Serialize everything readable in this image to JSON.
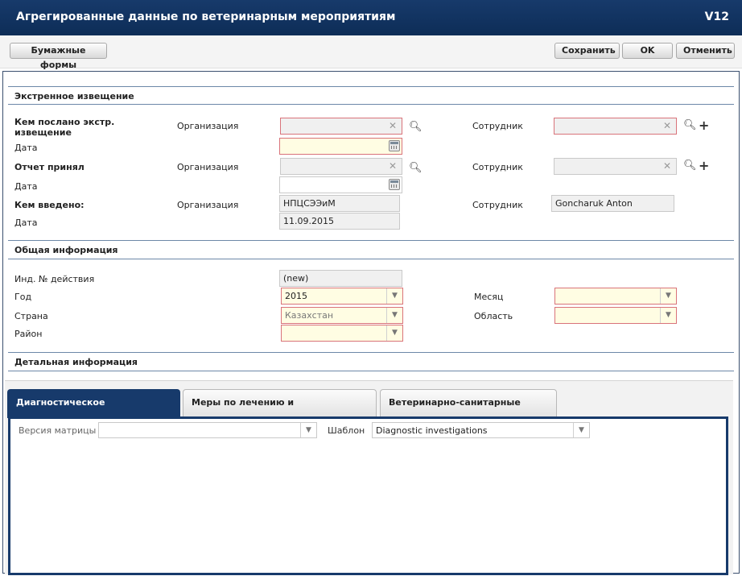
{
  "window": {
    "title": "Агрегированные данные по ветеринарным мероприятиям",
    "version": "V12"
  },
  "toolbar": {
    "paper_forms": "Бумажные формы",
    "save": "Сохранить",
    "ok": "OK",
    "cancel": "Отменить"
  },
  "emergency": {
    "title": "Экстренное извещение",
    "sent_by": "Кем послано экстр. извещение",
    "report_received": "Отчет принял",
    "entered_by": "Кем введено:",
    "org_label": "Организация",
    "employee_label": "Сотрудник",
    "date_label": "Дата",
    "entered_org": "НПЦСЭЭиМ",
    "entered_employee": "Goncharuk Anton",
    "entered_date": "11.09.2015"
  },
  "general": {
    "title": "Общая информация",
    "action_id_label": "Инд. № действия",
    "action_id_value": "(new)",
    "year_label": "Год",
    "year_value": "2015",
    "country_label": "Страна",
    "country_value": "Казахстан",
    "district_label": "Район",
    "month_label": "Месяц",
    "region_label": "Область"
  },
  "detail": {
    "title": "Детальная информация",
    "tabs": [
      {
        "label": "Диагностическое исследование",
        "active": true
      },
      {
        "label": "Меры по лечению и профилактике",
        "active": false
      },
      {
        "label": "Ветеринарно-санитарные меры",
        "active": false
      }
    ],
    "matrix_version_label": "Версия матрицы",
    "template_label": "Шаблон",
    "template_value": "Diagnostic investigations"
  },
  "colors": {
    "header": "#173a6b",
    "required_border": "#d9737a",
    "required_bg": "#fffde3"
  }
}
